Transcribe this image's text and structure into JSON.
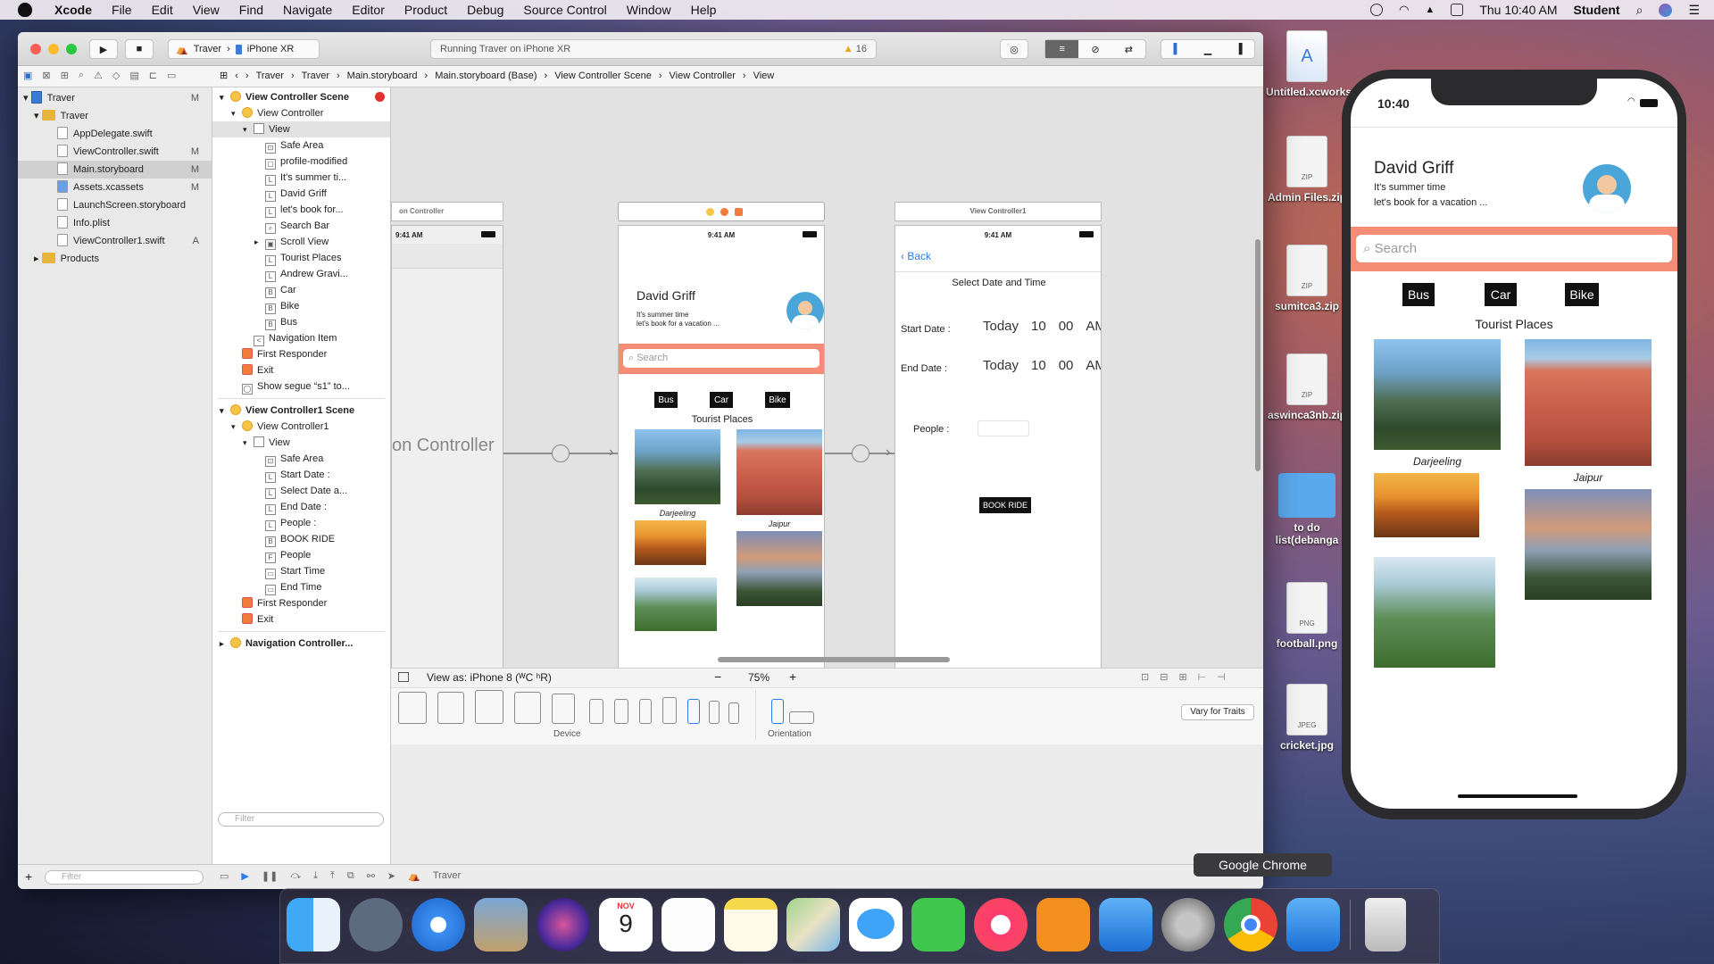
{
  "menubar": {
    "app": "Xcode",
    "items": [
      "File",
      "Edit",
      "View",
      "Find",
      "Navigate",
      "Editor",
      "Product",
      "Debug",
      "Source Control",
      "Window",
      "Help"
    ],
    "clock": "Thu 10:40 AM",
    "user": "Student"
  },
  "desktop": {
    "icons": [
      {
        "label": "Untitled.xcworkspace",
        "kind": "xcode"
      },
      {
        "label": "Admin Files.zip",
        "kind": "ZIP"
      },
      {
        "label": "sumitca3.zip",
        "kind": "ZIP"
      },
      {
        "label": "aswinca3nb.zip",
        "kind": "ZIP"
      },
      {
        "label": "to do list(debanga",
        "kind": "folder"
      },
      {
        "label": "football.png",
        "kind": "PNG"
      },
      {
        "label": "cricket.jpg",
        "kind": "JPEG"
      }
    ]
  },
  "xcode": {
    "scheme": "Traver",
    "device": "iPhone XR",
    "status": "Running Traver on iPhone XR",
    "warnings": "16",
    "breadcrumb": [
      "Traver",
      "Traver",
      "Main.storyboard",
      "Main.storyboard (Base)",
      "View Controller Scene",
      "View Controller",
      "View"
    ],
    "navigator": [
      {
        "label": "Traver",
        "status": "M",
        "indent": 0,
        "type": "project"
      },
      {
        "label": "Traver",
        "status": "",
        "indent": 1,
        "type": "folder"
      },
      {
        "label": "AppDelegate.swift",
        "status": "",
        "indent": 2,
        "type": "file"
      },
      {
        "label": "ViewController.swift",
        "status": "M",
        "indent": 2,
        "type": "file"
      },
      {
        "label": "Main.storyboard",
        "status": "M",
        "indent": 2,
        "type": "file",
        "selected": true
      },
      {
        "label": "Assets.xcassets",
        "status": "M",
        "indent": 2,
        "type": "file"
      },
      {
        "label": "LaunchScreen.storyboard",
        "status": "",
        "indent": 2,
        "type": "file"
      },
      {
        "label": "Info.plist",
        "status": "",
        "indent": 2,
        "type": "file"
      },
      {
        "label": "ViewController1.swift",
        "status": "A",
        "indent": 2,
        "type": "file"
      },
      {
        "label": "Products",
        "status": "",
        "indent": 1,
        "type": "folder"
      }
    ],
    "outline": [
      {
        "label": "View Controller Scene",
        "indent": 0,
        "icon": "scene",
        "header": true
      },
      {
        "label": "View Controller",
        "indent": 1,
        "icon": "vc"
      },
      {
        "label": "View",
        "indent": 2,
        "icon": "view",
        "highlight": true
      },
      {
        "label": "Safe Area",
        "indent": 3,
        "icon": "S"
      },
      {
        "label": "profile-modified",
        "indent": 3,
        "icon": "img"
      },
      {
        "label": "It's summer ti...",
        "indent": 3,
        "icon": "L"
      },
      {
        "label": "David Griff",
        "indent": 3,
        "icon": "L"
      },
      {
        "label": "let's book for...",
        "indent": 3,
        "icon": "L"
      },
      {
        "label": "Search Bar",
        "indent": 3,
        "icon": "sb"
      },
      {
        "label": "Scroll View",
        "indent": 3,
        "icon": "sv"
      },
      {
        "label": "Tourist Places",
        "indent": 3,
        "icon": "L"
      },
      {
        "label": "Andrew Gravi...",
        "indent": 3,
        "icon": "L"
      },
      {
        "label": "Car",
        "indent": 3,
        "icon": "B"
      },
      {
        "label": "Bike",
        "indent": 3,
        "icon": "B"
      },
      {
        "label": "Bus",
        "indent": 3,
        "icon": "B"
      },
      {
        "label": "Navigation Item",
        "indent": 2,
        "icon": "<"
      },
      {
        "label": "First Responder",
        "indent": 1,
        "icon": "fr"
      },
      {
        "label": "Exit",
        "indent": 1,
        "icon": "ex"
      },
      {
        "label": "Show segue “s1” to...",
        "indent": 1,
        "icon": "sg"
      },
      {
        "label": "View Controller1 Scene",
        "indent": 0,
        "icon": "scene",
        "header": true
      },
      {
        "label": "View Controller1",
        "indent": 1,
        "icon": "vc"
      },
      {
        "label": "View",
        "indent": 2,
        "icon": "view"
      },
      {
        "label": "Safe Area",
        "indent": 3,
        "icon": "S"
      },
      {
        "label": "Start Date :",
        "indent": 3,
        "icon": "L"
      },
      {
        "label": "Select Date a...",
        "indent": 3,
        "icon": "L"
      },
      {
        "label": "End Date :",
        "indent": 3,
        "icon": "L"
      },
      {
        "label": "People :",
        "indent": 3,
        "icon": "L"
      },
      {
        "label": "BOOK RIDE",
        "indent": 3,
        "icon": "B"
      },
      {
        "label": "People",
        "indent": 3,
        "icon": "F"
      },
      {
        "label": "Start Time",
        "indent": 3,
        "icon": "dp"
      },
      {
        "label": "End Time",
        "indent": 3,
        "icon": "dp"
      },
      {
        "label": "First Responder",
        "indent": 1,
        "icon": "fr"
      },
      {
        "label": "Exit",
        "indent": 1,
        "icon": "ex"
      },
      {
        "label": "Navigation Controller...",
        "indent": 0,
        "icon": "scene",
        "header": true
      }
    ],
    "canvas": {
      "nav_scene": {
        "title": "on Controller",
        "time": "9:41 AM",
        "big_label": "on Controller"
      },
      "vc_scene": {
        "time": "9:41 AM",
        "name": "David Griff",
        "line1": "It's summer time",
        "line2": "let's book for a vacation ...",
        "search": "Search",
        "buttons": [
          "Bus",
          "Car",
          "Bike"
        ],
        "section": "Tourist Places",
        "captions": [
          "Darjeeling",
          "Jaipur"
        ]
      },
      "vc1_scene": {
        "title": "View Controller1",
        "time": "9:41 AM",
        "back": "Back",
        "heading": "Select Date and Time",
        "start_label": "Start Date :",
        "end_label": "End Date :",
        "people_label": "People :",
        "picker": [
          "Today",
          "10",
          "00",
          "AM"
        ],
        "book": "BOOK RIDE"
      }
    },
    "canvas_bar": {
      "view_as": "View as: iPhone 8 (ᵂC ʰR)",
      "zoom": "75%"
    },
    "device_bar": {
      "device_label": "Device",
      "orientation_label": "Orientation",
      "vary": "Vary for Traits"
    },
    "filter_placeholder": "Filter",
    "debug_target": "Traver"
  },
  "simulator": {
    "time": "10:40",
    "name": "David Griff",
    "line1": "It's summer time",
    "line2": "let's book for a vacation ...",
    "search": "Search",
    "buttons": [
      "Bus",
      "Car",
      "Bike"
    ],
    "section": "Tourist Places",
    "captions": [
      "Darjeeling",
      "Jaipur"
    ],
    "accent": "#f48c76"
  },
  "dock": {
    "tooltip": "Google Chrome",
    "calendar_month": "NOV",
    "calendar_day": "9",
    "apps": [
      "Finder",
      "Launchpad",
      "Safari",
      "Preview",
      "Siri",
      "Calendar",
      "Reminders",
      "Notes",
      "Maps",
      "Messages",
      "FaceTime",
      "iTunes",
      "iBooks",
      "Xcode",
      "System Preferences",
      "Google Chrome",
      "Simulator",
      "Trash"
    ]
  }
}
